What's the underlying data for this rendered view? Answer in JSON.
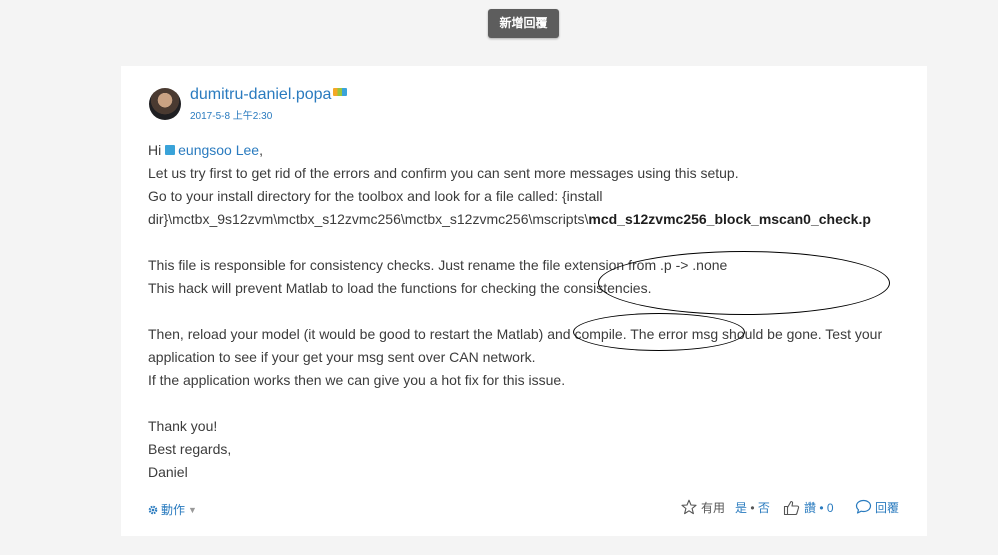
{
  "toolbar": {
    "add_reply_label": "新增回覆"
  },
  "post": {
    "author": "dumitru-daniel.popa",
    "date": "2017-5-8 上午2:30",
    "greeting_prefix": "Hi ",
    "mention": "eungsoo Lee",
    "greeting_suffix": ",",
    "line1": "Let us try first to get rid of the errors and confirm you can sent more messages using this setup.",
    "line2": "Go to your install directory for the toolbox and look for a file called: {install",
    "line3_path": "dir}\\mctbx_9s12zvm\\mctbx_s12zvmc256\\mctbx_s12zvmc256\\mscripts\\",
    "line3_file": "mcd_s12zvmc256_block_mscan0_check.p",
    "line4": "This file is responsible for consistency checks. Just rename the file extension from .p -> .none",
    "line5": "This hack will prevent Matlab to load the functions for checking the consistencies.",
    "line6": "Then, reload your model (it would be good to restart the Matlab) and compile. The error msg should be gone. Test your",
    "line7": "application to see if your get your msg sent over CAN network.",
    "line8": "If the application works then we can give you a hot fix for this issue.",
    "closing1": "Thank you!",
    "closing2": "Best regards,",
    "closing3": "Daniel"
  },
  "actions": {
    "menu_label": "動作",
    "helpful_label": "有用",
    "helpful_yes": "是",
    "helpful_sep": " • ",
    "helpful_no": "否",
    "like_label": "讚",
    "like_sep": " • ",
    "like_count": "0",
    "reply_label": "回覆"
  },
  "icons": {
    "avatar": "user-photo",
    "rank": "rank-badge-icon",
    "mention": "user-mention-icon",
    "menu": "gear-icon",
    "helpful": "star-icon",
    "like": "thumbs-up-icon",
    "reply": "comment-icon"
  },
  "colors": {
    "link": "#2a7bbf",
    "button_bg": "#5d5d5d",
    "page_bg": "#f4f4f4"
  }
}
